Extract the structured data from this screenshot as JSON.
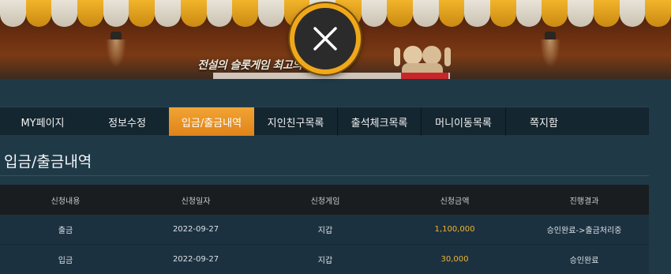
{
  "banner": {
    "tagline": "전설의 슬롯게임 최고의 도구슬롯"
  },
  "close_button": {
    "icon": "close-icon"
  },
  "tabs": [
    {
      "label": "MY페이지",
      "active": false
    },
    {
      "label": "정보수정",
      "active": false
    },
    {
      "label": "입금/출금내역",
      "active": true
    },
    {
      "label": "지인친구목록",
      "active": false
    },
    {
      "label": "출석체크목록",
      "active": false
    },
    {
      "label": "머니이동목록",
      "active": false
    },
    {
      "label": "쪽지함",
      "active": false
    }
  ],
  "page_title": "입금/출금내역",
  "table": {
    "headers": [
      "신청내용",
      "신청일자",
      "신청게임",
      "신청금액",
      "진행결과"
    ],
    "rows": [
      {
        "type": "출금",
        "date": "2022-09-27",
        "game": "지갑",
        "amount": "1,100,000",
        "result": "승인완료->출금처리중"
      },
      {
        "type": "입금",
        "date": "2022-09-27",
        "game": "지갑",
        "amount": "30,000",
        "result": "승인완료"
      }
    ]
  },
  "colors": {
    "accent": "#f0a432",
    "amount": "#f0b530",
    "background": "#1f3947"
  }
}
